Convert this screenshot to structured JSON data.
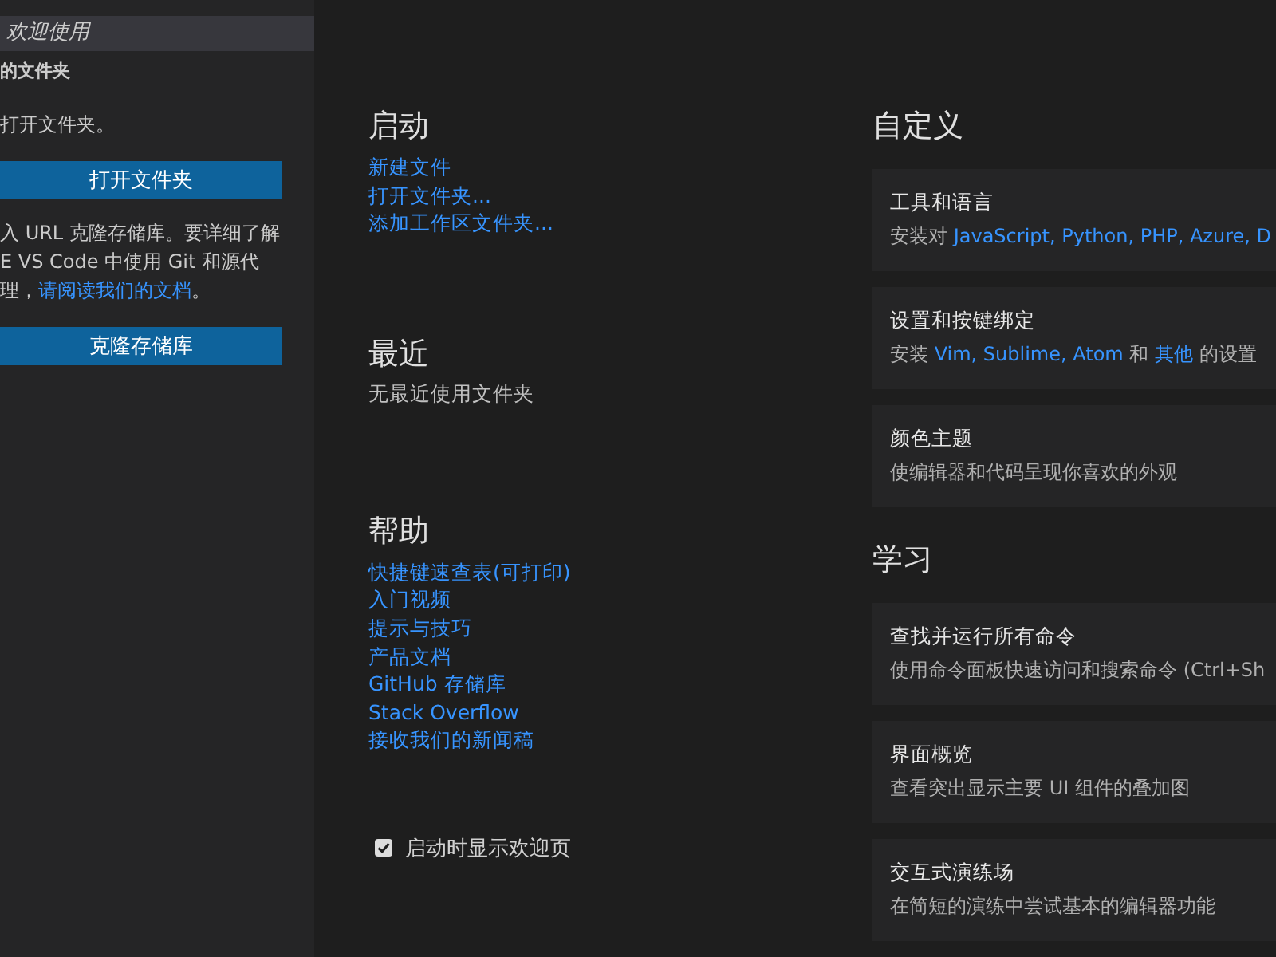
{
  "sidebar": {
    "item": {
      "label": "欢迎使用",
      "selected": true
    },
    "section_title": "的文件夹",
    "message": "打开文件夹。",
    "open_button": "打开文件夹",
    "clone_text": {
      "lines": [
        "入 URL 克隆存储库。要详细了解",
        "E VS Code 中使用 Git 和源代"
      ],
      "prefix": "理，",
      "link": "请阅读我们的文档",
      "suffix": "。"
    },
    "clone_button": "克隆存储库"
  },
  "start": {
    "title": "启动",
    "links": [
      "新建文件",
      "打开文件夹...",
      "添加工作区文件夹..."
    ]
  },
  "recent": {
    "title": "最近",
    "empty_text": "无最近使用文件夹"
  },
  "help": {
    "title": "帮助",
    "links": [
      "快捷键速查表(可打印)",
      "入门视频",
      "提示与技巧",
      "产品文档",
      "GitHub 存储库",
      "Stack Overflow",
      "接收我们的新闻稿"
    ]
  },
  "show_on_startup": {
    "label": "启动时显示欢迎页",
    "checked": true
  },
  "customize": {
    "title": "自定义",
    "cards": [
      {
        "title": "工具和语言",
        "description": [
          {
            "text": "安装对 ",
            "link": false
          },
          {
            "text": "JavaScript, Python, PHP, Azure, D",
            "link": true
          }
        ]
      },
      {
        "title": "设置和按键绑定",
        "description": [
          {
            "text": "安装 ",
            "link": false
          },
          {
            "text": "Vim, Sublime, Atom",
            "link": true
          },
          {
            "text": " 和 ",
            "link": false
          },
          {
            "text": "其他",
            "link": true
          },
          {
            "text": " 的设置",
            "link": false
          }
        ]
      },
      {
        "title": "颜色主题",
        "description": [
          {
            "text": "使编辑器和代码呈现你喜欢的外观",
            "link": false
          }
        ]
      }
    ]
  },
  "learn": {
    "title": "学习",
    "cards": [
      {
        "title": "查找并运行所有命令",
        "description": [
          {
            "text": "使用命令面板快速访问和搜索命令 (Ctrl+Sh",
            "link": false
          }
        ]
      },
      {
        "title": "界面概览",
        "description": [
          {
            "text": "查看突出显示主要 UI 组件的叠加图",
            "link": false
          }
        ]
      },
      {
        "title": "交互式演练场",
        "description": [
          {
            "text": "在简短的演练中尝试基本的编辑器功能",
            "link": false
          }
        ]
      }
    ]
  }
}
